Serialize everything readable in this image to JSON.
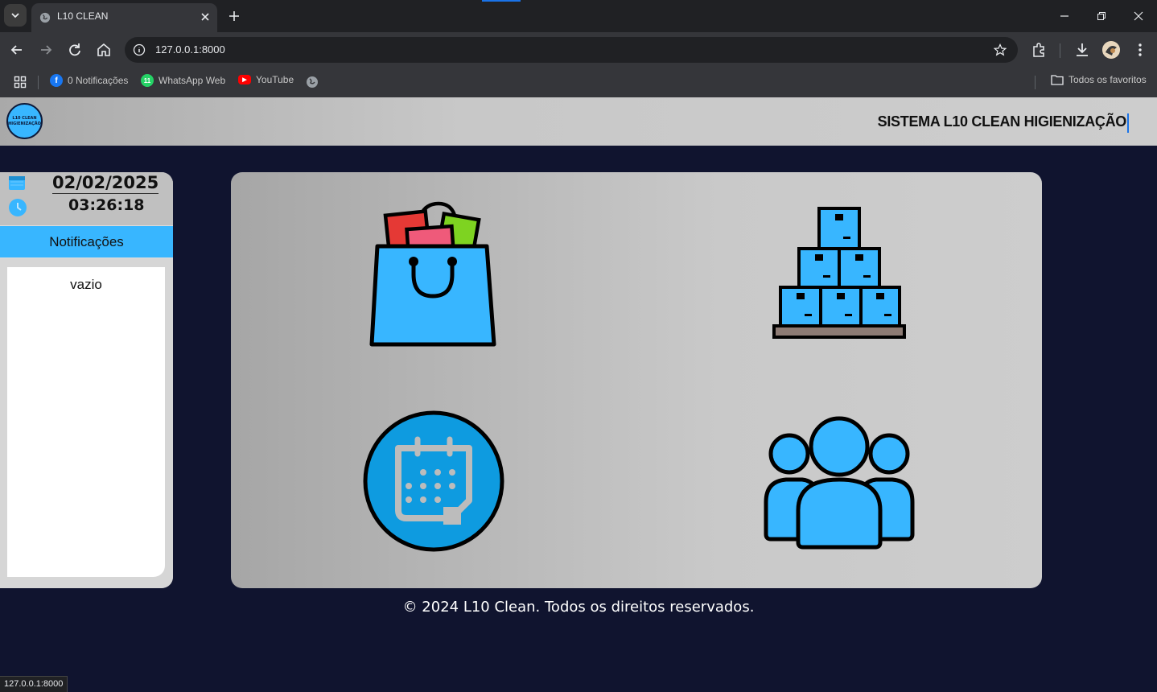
{
  "browser": {
    "tab_title": "L10 CLEAN",
    "url": "127.0.0.1:8000",
    "bookmarks": [
      {
        "label": "0 Notificações",
        "icon": "facebook-icon"
      },
      {
        "label": "WhatsApp Web",
        "icon": "whatsapp-icon"
      },
      {
        "label": "YouTube",
        "icon": "youtube-icon"
      }
    ],
    "all_bookmarks_label": "Todos os favoritos",
    "status_url": "127.0.0.1:8000"
  },
  "header": {
    "logo_line1": "L10 CLEAN",
    "logo_line2": "HIGIENIZAÇÃO",
    "title": "SISTEMA L10 CLEAN HIGIENIZAÇÃO"
  },
  "sidebar": {
    "date": "02/02/2025",
    "time": "03:26:18",
    "notifications_label": "Notificações",
    "empty_label": "vazio"
  },
  "menu": {
    "tiles": [
      "shopping-bag-icon",
      "boxes-stack-icon",
      "calendar-icon",
      "users-group-icon"
    ]
  },
  "colors": {
    "accent": "#38b6ff",
    "background": "#10142f",
    "calendar_circle": "#0e9be0"
  },
  "footer": {
    "text": "© 2024 L10 Clean. Todos os direitos reservados."
  }
}
